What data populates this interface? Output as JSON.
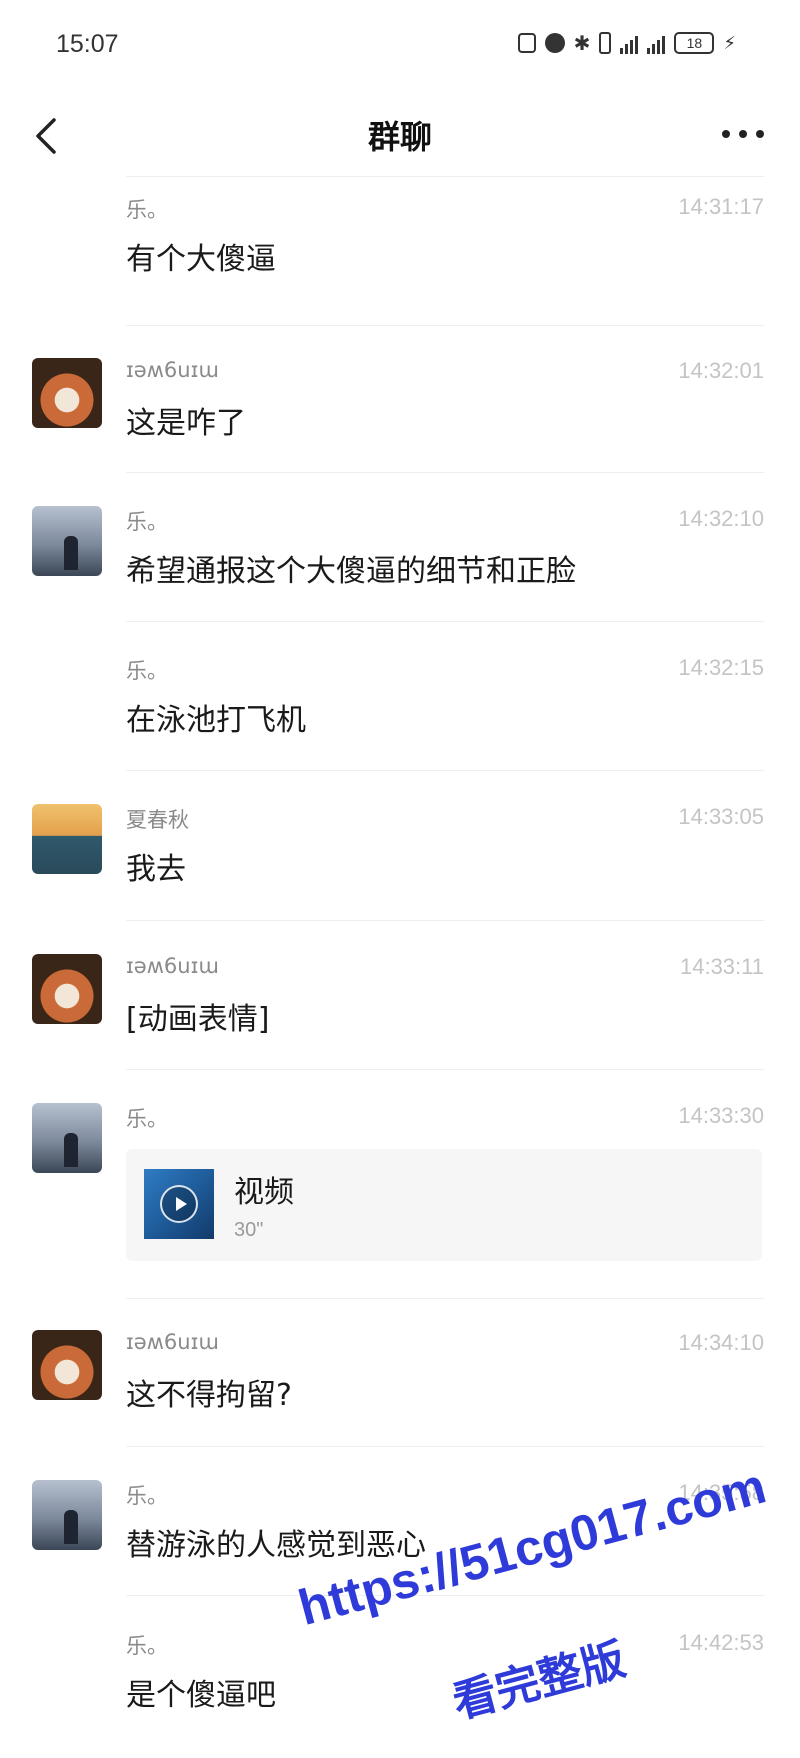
{
  "status_bar": {
    "time": "15:07",
    "battery": "18",
    "icons": [
      "nfc-icon",
      "alarm-icon",
      "bluetooth-icon",
      "vibrate-icon",
      "signal-5g-icon",
      "signal-5g-icon",
      "battery-icon",
      "charging-icon"
    ]
  },
  "header": {
    "title": "群聊",
    "back_icon": "chevron-left-icon",
    "more_icon": "more-dots-icon"
  },
  "messages": [
    {
      "sender": "乐。",
      "time": "14:31:17",
      "text": "有个大傻逼",
      "avatar": "none"
    },
    {
      "sender": "ɪəʍ6uɪɯ",
      "time": "14:32:01",
      "text": "这是咋了",
      "avatar": "red-panda"
    },
    {
      "sender": "乐。",
      "time": "14:32:10",
      "text": "希望通报这个大傻逼的细节和正脸",
      "avatar": "dusk-figure"
    },
    {
      "sender": "乐。",
      "time": "14:32:15",
      "text": "在泳池打飞机",
      "avatar": "none"
    },
    {
      "sender": "夏春秋",
      "time": "14:33:05",
      "text": "我去",
      "avatar": "duck"
    },
    {
      "sender": "ɪəʍ6uɪɯ",
      "time": "14:33:11",
      "text": "[动画表情]",
      "avatar": "red-panda"
    },
    {
      "sender": "乐。",
      "time": "14:33:30",
      "video": {
        "label": "视频",
        "duration": "30\""
      },
      "avatar": "dusk-figure"
    },
    {
      "sender": "ɪəʍ6uɪɯ",
      "time": "14:34:10",
      "text": "这不得拘留?",
      "avatar": "red-panda"
    },
    {
      "sender": "乐。",
      "time": "14:35:58",
      "text": "替游泳的人感觉到恶心",
      "avatar": "dusk-figure"
    },
    {
      "sender": "乐。",
      "time": "14:42:53",
      "text": "是个傻逼吧",
      "avatar": "none"
    }
  ],
  "watermark": {
    "url": "https://51cg017.com",
    "subtitle": "看完整版"
  },
  "colors": {
    "time_text": "#c4c4c4",
    "sender_text": "#8a8a8a",
    "watermark": "#2f3bd8"
  }
}
